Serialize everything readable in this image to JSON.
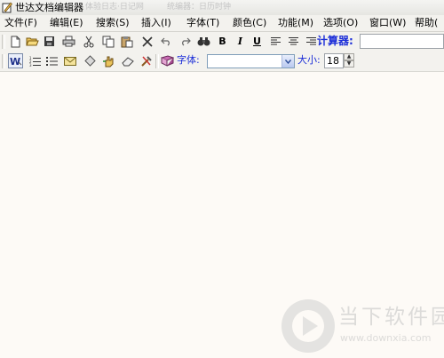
{
  "window": {
    "title": "世达文档编辑器",
    "ghost_tabs": [
      "体验日志·日记网",
      "统编器：日历时钟"
    ]
  },
  "menu": [
    {
      "label": "文件(F)"
    },
    {
      "label": "编辑(E)"
    },
    {
      "label": "搜索(S)"
    },
    {
      "label": "插入(I)"
    },
    {
      "label": "字体(T)"
    },
    {
      "label": "颜色(C)"
    },
    {
      "label": "功能(M)"
    },
    {
      "label": "选项(O)"
    },
    {
      "label": "窗口(W)"
    },
    {
      "label": "帮助("
    }
  ],
  "toolbar1": {
    "icons": [
      "new-document",
      "open-folder",
      "save",
      "print",
      "cut",
      "copy",
      "paste",
      "delete",
      "undo",
      "redo",
      "find",
      "bold",
      "italic",
      "underline",
      "align-left",
      "align-center",
      "align-right"
    ],
    "glyphs": {
      "bold": "B",
      "italic": "I",
      "underline": "U"
    },
    "label": "计算器:"
  },
  "toolbar2": {
    "icons": [
      "word-format",
      "numbered-list",
      "bullet-list",
      "envelope",
      "diamond",
      "hand",
      "eraser",
      "tools",
      "book"
    ],
    "font_label": "字体:",
    "font_value": "",
    "size_label": "大小:",
    "size_value": "18"
  },
  "watermark": {
    "title": "当下软件园",
    "url": "www.downxia.com"
  }
}
